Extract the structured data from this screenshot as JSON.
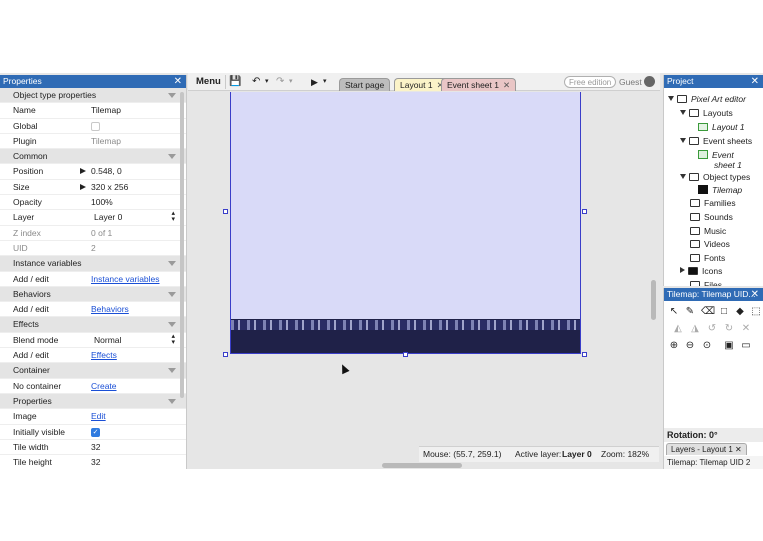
{
  "properties_panel": {
    "title": "Properties",
    "close": "✕",
    "rows": [
      {
        "type": "section",
        "label": "Object type properties"
      },
      {
        "type": "text",
        "label": "Name",
        "value": "Tilemap"
      },
      {
        "type": "check",
        "label": "Global",
        "checked": false
      },
      {
        "type": "text",
        "label": "Plugin",
        "value": "Tilemap",
        "muted": true
      },
      {
        "type": "section",
        "label": "Common"
      },
      {
        "type": "expand",
        "label": "Position",
        "value": "0.548, 0"
      },
      {
        "type": "expand",
        "label": "Size",
        "value": "320 x 256"
      },
      {
        "type": "text",
        "label": "Opacity",
        "value": "100%"
      },
      {
        "type": "select",
        "label": "Layer",
        "value": "Layer 0"
      },
      {
        "type": "text",
        "label": "Z index",
        "value": "0 of 1",
        "muted": true,
        "label_muted": true
      },
      {
        "type": "text",
        "label": "UID",
        "value": "2",
        "muted": true,
        "label_muted": true
      },
      {
        "type": "section",
        "label": "Instance variables"
      },
      {
        "type": "link",
        "label": "Add / edit",
        "value": "Instance variables"
      },
      {
        "type": "section",
        "label": "Behaviors"
      },
      {
        "type": "link",
        "label": "Add / edit",
        "value": "Behaviors"
      },
      {
        "type": "section",
        "label": "Effects"
      },
      {
        "type": "select",
        "label": "Blend mode",
        "value": "Normal"
      },
      {
        "type": "link",
        "label": "Add / edit",
        "value": "Effects"
      },
      {
        "type": "section",
        "label": "Container"
      },
      {
        "type": "link",
        "label": "No container",
        "value": "Create"
      },
      {
        "type": "section",
        "label": "Properties"
      },
      {
        "type": "link",
        "label": "Image",
        "value": "Edit"
      },
      {
        "type": "check",
        "label": "Initially visible",
        "checked": true
      },
      {
        "type": "text",
        "label": "Tile width",
        "value": "32"
      },
      {
        "type": "text",
        "label": "Tile height",
        "value": "32"
      }
    ]
  },
  "toolbar": {
    "menu_label": "Menu",
    "save_icon": "💾",
    "undo_icon": "↶",
    "redo_icon": "↷",
    "play_icon": "▶",
    "dropdown_icon": "▾",
    "free_edition": "Free edition",
    "guest": "Guest"
  },
  "tabs": [
    {
      "label": "Start page",
      "color": "#bdbdbd",
      "active": false
    },
    {
      "label": "Layout 1",
      "color": "#fbf3c8",
      "active": true
    },
    {
      "label": "Event sheet 1",
      "color": "#e9c6c6",
      "active": false
    }
  ],
  "tab_close": "✕",
  "status_bar": {
    "mouse": "Mouse: (55.7, 259.1)",
    "active_layer_label": "Active layer:",
    "active_layer_value": "Layer 0",
    "zoom": "Zoom: 182%"
  },
  "project_panel": {
    "title": "Project",
    "close": "✕",
    "items": [
      {
        "label": "Pixel Art editor",
        "icon": "folder",
        "caret": "down",
        "italic": true
      },
      {
        "label": "Layouts",
        "icon": "folder",
        "caret": "down"
      },
      {
        "label": "Layout 1",
        "icon": "layout",
        "italic": true
      },
      {
        "label": "Event sheets",
        "icon": "folder",
        "caret": "down"
      },
      {
        "label": "Event",
        "label2": "sheet 1",
        "icon": "event",
        "italic": true
      },
      {
        "label": "Object types",
        "icon": "folder",
        "caret": "down"
      },
      {
        "label": "Tilemap",
        "icon": "tilemap",
        "italic": true
      },
      {
        "label": "Families",
        "icon": "folder"
      },
      {
        "label": "Sounds",
        "icon": "folder"
      },
      {
        "label": "Music",
        "icon": "folder"
      },
      {
        "label": "Videos",
        "icon": "folder"
      },
      {
        "label": "Fonts",
        "icon": "folder"
      },
      {
        "label": "Icons",
        "icon": "folder-filled",
        "caret": "right"
      },
      {
        "label": "Files",
        "icon": "folder"
      }
    ]
  },
  "tilemap_panel": {
    "title": "Tilemap: Tilemap UID...",
    "close": "✕",
    "tools_row1": [
      "cursor-icon",
      "pencil-icon",
      "eraser-icon",
      "rectangle-icon",
      "fill-icon",
      "dashed-rect-icon"
    ],
    "tools_row2": [
      "mirror-icon",
      "flip-icon",
      "rotate-ccw-icon",
      "rotate-cw-icon",
      "clear-icon"
    ],
    "tools_row3": [
      "zoom-in-icon",
      "zoom-out-icon",
      "zoom-reset-icon",
      "save-icon",
      "folder-icon"
    ],
    "rotation": "Rotation: 0°",
    "layers_tab": "Layers - Layout 1",
    "layers_tab_close": "✕",
    "status": "Tilemap: Tilemap UID 2"
  }
}
